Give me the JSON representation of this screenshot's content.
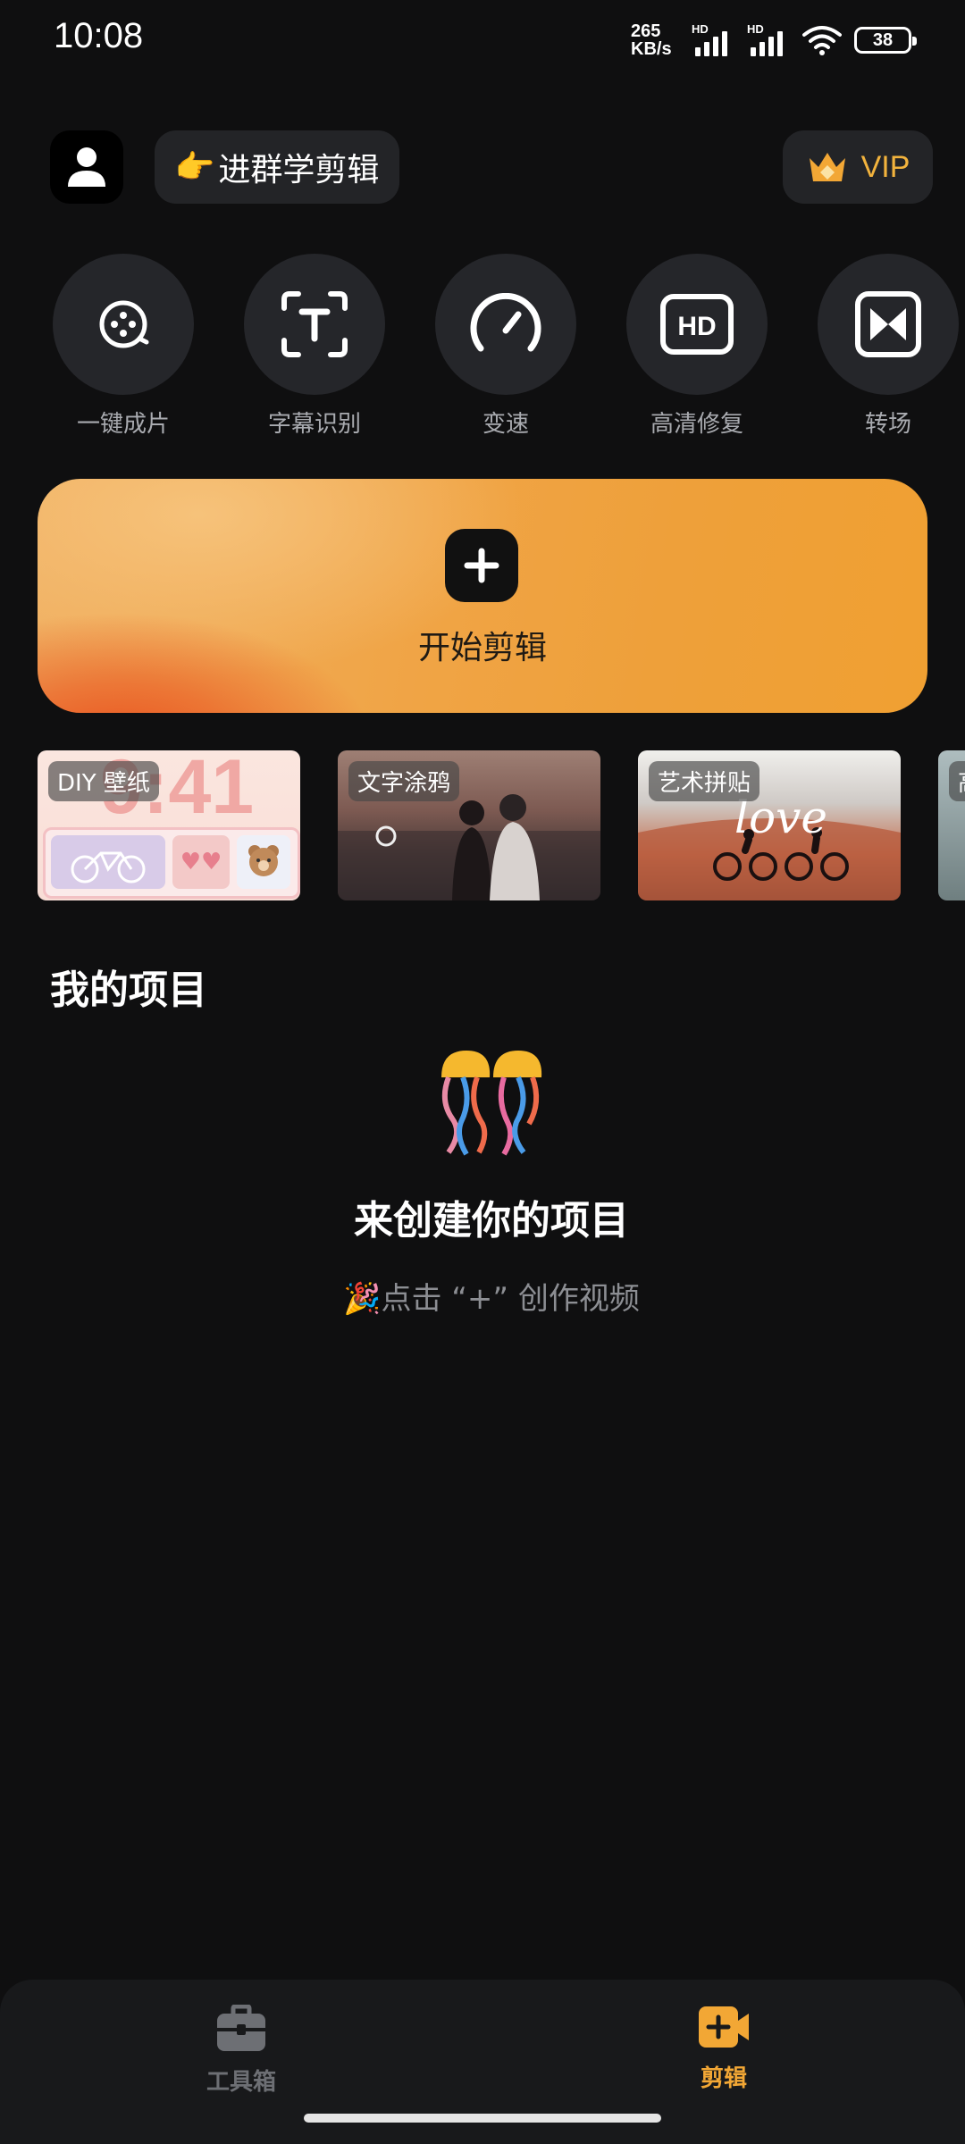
{
  "status_bar": {
    "time": "10:08",
    "net_speed_value": "265",
    "net_speed_unit": "KB/s",
    "sim1_label": "HD",
    "sim2_label": "HD",
    "battery": "38"
  },
  "header": {
    "group_emoji": "👉",
    "group_label": "进群学剪辑",
    "vip_label": "VIP"
  },
  "tools": [
    {
      "label": "一键成片",
      "icon": "film-reel-icon"
    },
    {
      "label": "字幕识别",
      "icon": "text-scan-icon"
    },
    {
      "label": "变速",
      "icon": "speedometer-icon"
    },
    {
      "label": "高清修复",
      "icon": "hd-icon"
    },
    {
      "label": "转场",
      "icon": "transition-icon"
    }
  ],
  "start": {
    "label": "开始剪辑"
  },
  "templates": [
    {
      "tag": "DIY 壁纸",
      "time_text": "9:41"
    },
    {
      "tag": "文字涂鸦"
    },
    {
      "tag": "艺术拼贴",
      "script_text": "love"
    },
    {
      "tag": "高"
    }
  ],
  "projects": {
    "title": "我的项目",
    "empty_title": "来创建你的项目",
    "empty_hint_emoji": "🎉",
    "empty_hint": "点击 “+” 创作视频"
  },
  "bottom_nav": {
    "tools_label": "工具箱",
    "edit_label": "剪辑",
    "active": "剪辑"
  },
  "colors": {
    "accent": "#f2a735",
    "background": "#0f0f10",
    "card": "#25262a"
  }
}
